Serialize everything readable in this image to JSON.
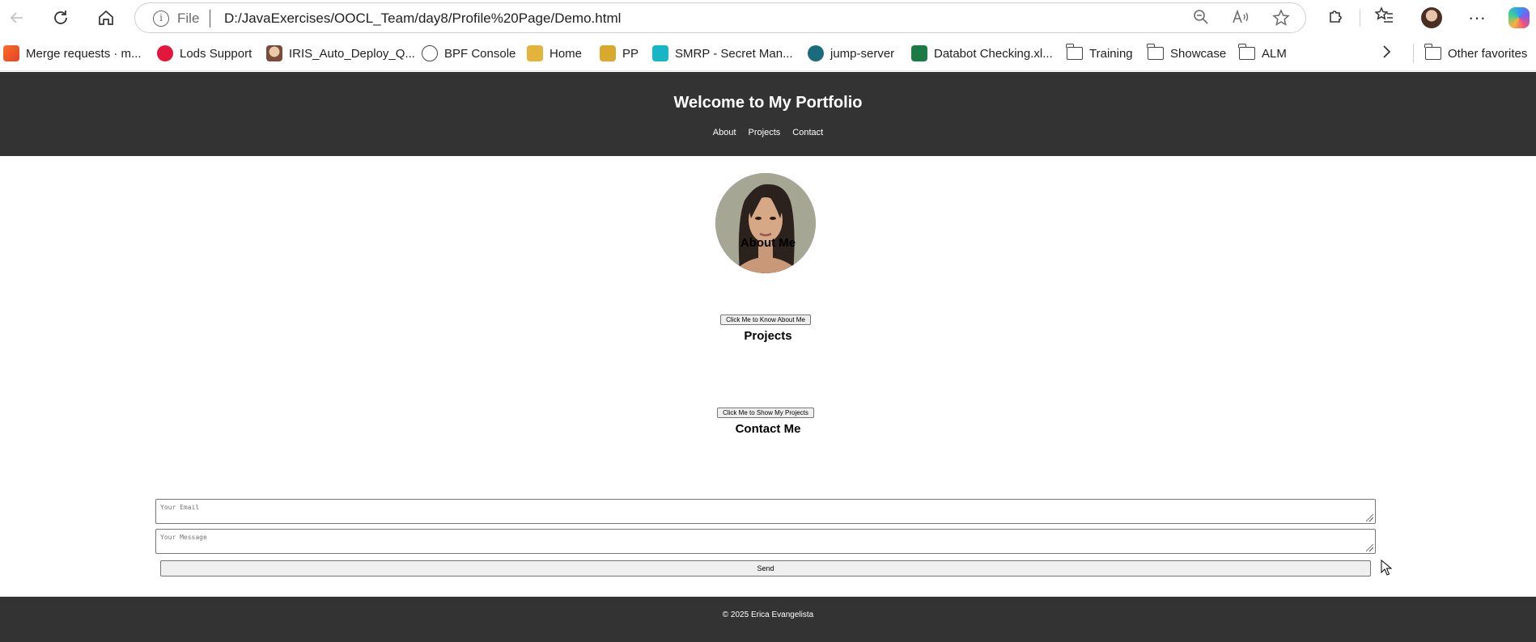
{
  "browser": {
    "address": {
      "scheme_label": "File",
      "url": "D:/JavaExercises/OOCL_Team/day8/Profile%20Page/Demo.html"
    },
    "bookmarks": [
      {
        "label": "Merge requests · m...",
        "icon": "gitlab-icon"
      },
      {
        "label": "Lods Support",
        "icon": "lods-icon"
      },
      {
        "label": "IRIS_Auto_Deploy_Q...",
        "icon": "jenkins-icon"
      },
      {
        "label": "BPF Console",
        "icon": "globe-icon"
      },
      {
        "label": "Home",
        "icon": "home-app-icon"
      },
      {
        "label": "PP",
        "icon": "pp-app-icon"
      },
      {
        "label": "SMRP - Secret Man...",
        "icon": "smrp-icon"
      },
      {
        "label": "jump-server",
        "icon": "jump-server-icon"
      },
      {
        "label": "Databot Checking.xl...",
        "icon": "excel-icon"
      },
      {
        "label": "Training",
        "icon": "folder-icon"
      },
      {
        "label": "Showcase",
        "icon": "folder-icon"
      },
      {
        "label": "ALM",
        "icon": "folder-icon"
      }
    ],
    "other_favorites": "Other favorites"
  },
  "site": {
    "title": "Welcome to My Portfolio",
    "nav": [
      "About",
      "Projects",
      "Contact"
    ],
    "about": {
      "heading": "About Me",
      "button": "Click Me to Know About Me"
    },
    "projects": {
      "heading": "Projects",
      "button": "Click Me to Show My Projects"
    },
    "contact": {
      "heading": "Contact Me",
      "email_placeholder": "Your Email",
      "message_placeholder": "Your Message",
      "send_label": "Send"
    },
    "footer": "© 2025 Erica Evangelista"
  },
  "colors": {
    "header_bg": "#333333",
    "footer_bg": "#333333",
    "page_bg": "#ffffff"
  }
}
